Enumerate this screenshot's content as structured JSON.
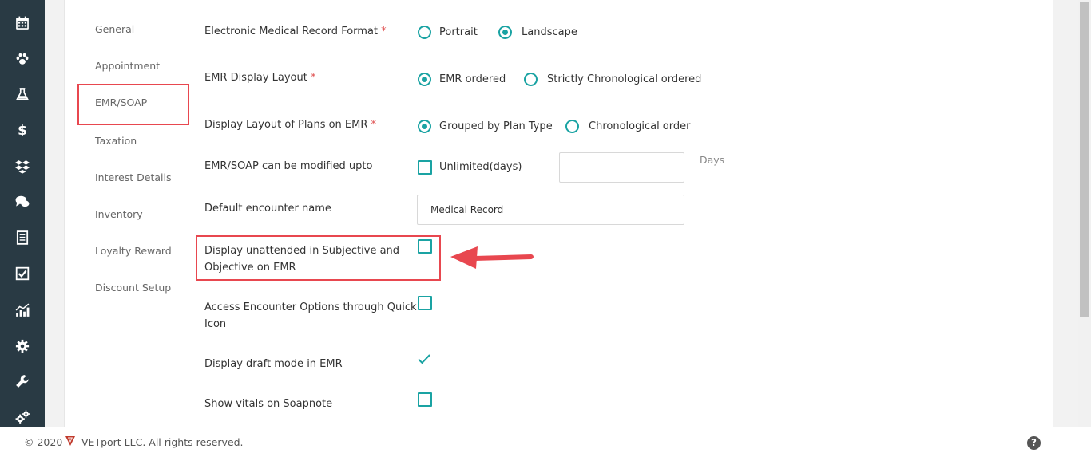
{
  "sidebar": {
    "icons": [
      "calendar-icon",
      "paw-icon",
      "flask-icon",
      "dollar-icon",
      "boxes-icon",
      "chat-icon",
      "document-icon",
      "checklist-icon",
      "chart-icon",
      "gear-icon",
      "wrench-icon",
      "gears-icon"
    ]
  },
  "subnav": {
    "items": [
      {
        "label": "General"
      },
      {
        "label": "Appointment"
      },
      {
        "label": "EMR/SOAP"
      },
      {
        "label": "Taxation"
      },
      {
        "label": "Interest Details"
      },
      {
        "label": "Inventory"
      },
      {
        "label": "Loyalty Reward"
      },
      {
        "label": "Discount Setup"
      }
    ],
    "active": "EMR/SOAP"
  },
  "form": {
    "emr_format": {
      "label": "Electronic Medical Record Format",
      "required_mark": "*",
      "options": [
        "Portrait",
        "Landscape"
      ],
      "selected": "Landscape"
    },
    "emr_display_layout": {
      "label": "EMR Display Layout",
      "required_mark": "*",
      "options": [
        "EMR ordered",
        "Strictly Chronological ordered"
      ],
      "selected": "EMR ordered"
    },
    "plans_layout": {
      "label": "Display Layout of Plans on EMR",
      "required_mark": "*",
      "options": [
        "Grouped by Plan Type",
        "Chronological order"
      ],
      "selected": "Grouped by Plan Type"
    },
    "modify_upto": {
      "label": "EMR/SOAP can be modified upto",
      "checkbox_label": "Unlimited(days)",
      "checked": false,
      "value": "",
      "unit": "Days"
    },
    "default_encounter": {
      "label": "Default encounter name",
      "value": "Medical Record"
    },
    "display_unattended": {
      "label_line1": "Display unattended in Subjective and",
      "label_line2": "Objective on EMR",
      "checked": false
    },
    "quick_icon": {
      "label_line1": "Access Encounter Options through Quick",
      "label_line2": "Icon",
      "checked": false
    },
    "draft_mode": {
      "label": "Display draft mode in EMR",
      "checked": true
    },
    "show_vitals": {
      "label": "Show vitals on Soapnote",
      "checked": false
    }
  },
  "footer": {
    "copyright": "© 2020",
    "company": "VETport LLC. All rights reserved.",
    "help": "?"
  },
  "colors": {
    "accent": "#1aa3a3",
    "sidebar": "#293a44",
    "highlight": "#e8474f"
  }
}
